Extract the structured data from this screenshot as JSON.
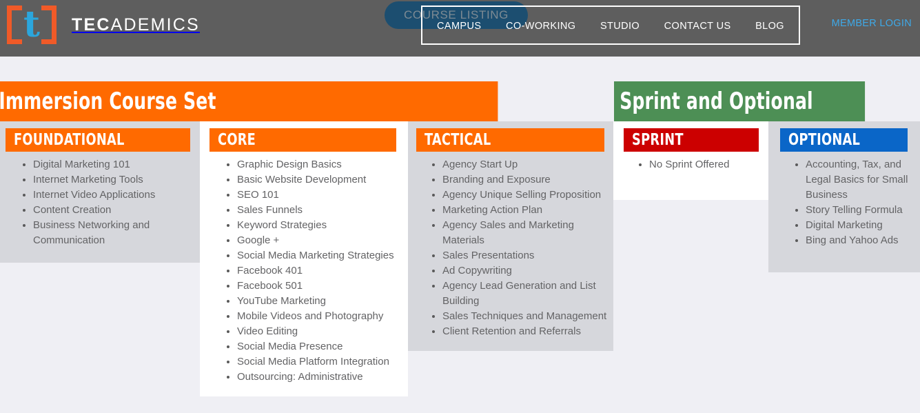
{
  "header": {
    "logo": {
      "bracket_open": "[",
      "letter": "t",
      "bracket_close": "]"
    },
    "brand_bold": "TEC",
    "brand_light": "ADEMICS",
    "course_listing_button": "COURSE LISTING",
    "nav_items": [
      {
        "label": "CAMPUS"
      },
      {
        "label": "CO-WORKING"
      },
      {
        "label": "STUDIO"
      },
      {
        "label": "CONTACT US"
      },
      {
        "label": "BLOG"
      }
    ],
    "member_login": "MEMBER LOGIN",
    "colors": {
      "header_bg": "#5e5e5e",
      "pill_bg": "#1c4e70",
      "member_login": "#3ea9e8",
      "logo_bracket": "#f05a28",
      "logo_letter": "#2ba6dd"
    }
  },
  "banners": [
    {
      "title": "Immersion Course Set",
      "color": "#ff6a00"
    },
    {
      "title": "Sprint and Optional",
      "color": "#4d8f55"
    }
  ],
  "columns": [
    {
      "heading": "FOUNDATIONAL",
      "heading_color": "#ff6a00",
      "background": "#d6d7dc",
      "items": [
        "Digital Marketing 101",
        "Internet Marketing Tools",
        "Internet Video Applications",
        "Content Creation",
        "Business Networking and Communication"
      ]
    },
    {
      "heading": "CORE",
      "heading_color": "#ff6a00",
      "background": "#ffffff",
      "items": [
        "Graphic Design Basics",
        "Basic Website Development",
        "SEO 101",
        "Sales Funnels",
        "Keyword Strategies",
        "Google +",
        "Social Media Marketing Strategies",
        "Facebook 401",
        "Facebook 501",
        "YouTube Marketing",
        "Mobile Videos and Photography",
        "Video Editing",
        "Social Media Presence",
        "Social Media Platform Integration",
        "Outsourcing: Administrative"
      ]
    },
    {
      "heading": "TACTICAL",
      "heading_color": "#ff6a00",
      "background": "#d6d7dc",
      "items": [
        "Agency Start Up",
        "Branding and Exposure",
        "Agency Unique Selling Proposition",
        "Marketing Action Plan",
        "Agency Sales and Marketing Materials",
        "Sales Presentations",
        "Ad Copywriting",
        "Agency Lead Generation and List Building",
        "Sales Techniques and Management",
        "Client Retention and Referrals"
      ]
    },
    {
      "heading": "SPRINT",
      "heading_color": "#cc0000",
      "background": "#ffffff",
      "items": [
        "No Sprint Offered"
      ]
    },
    {
      "heading": "OPTIONAL",
      "heading_color": "#0a66c8",
      "background": "#d6d7dc",
      "items": [
        "Accounting, Tax, and Legal Basics for Small Business",
        "Story Telling Formula",
        "Digital Marketing",
        "Bing and Yahoo Ads"
      ]
    }
  ]
}
